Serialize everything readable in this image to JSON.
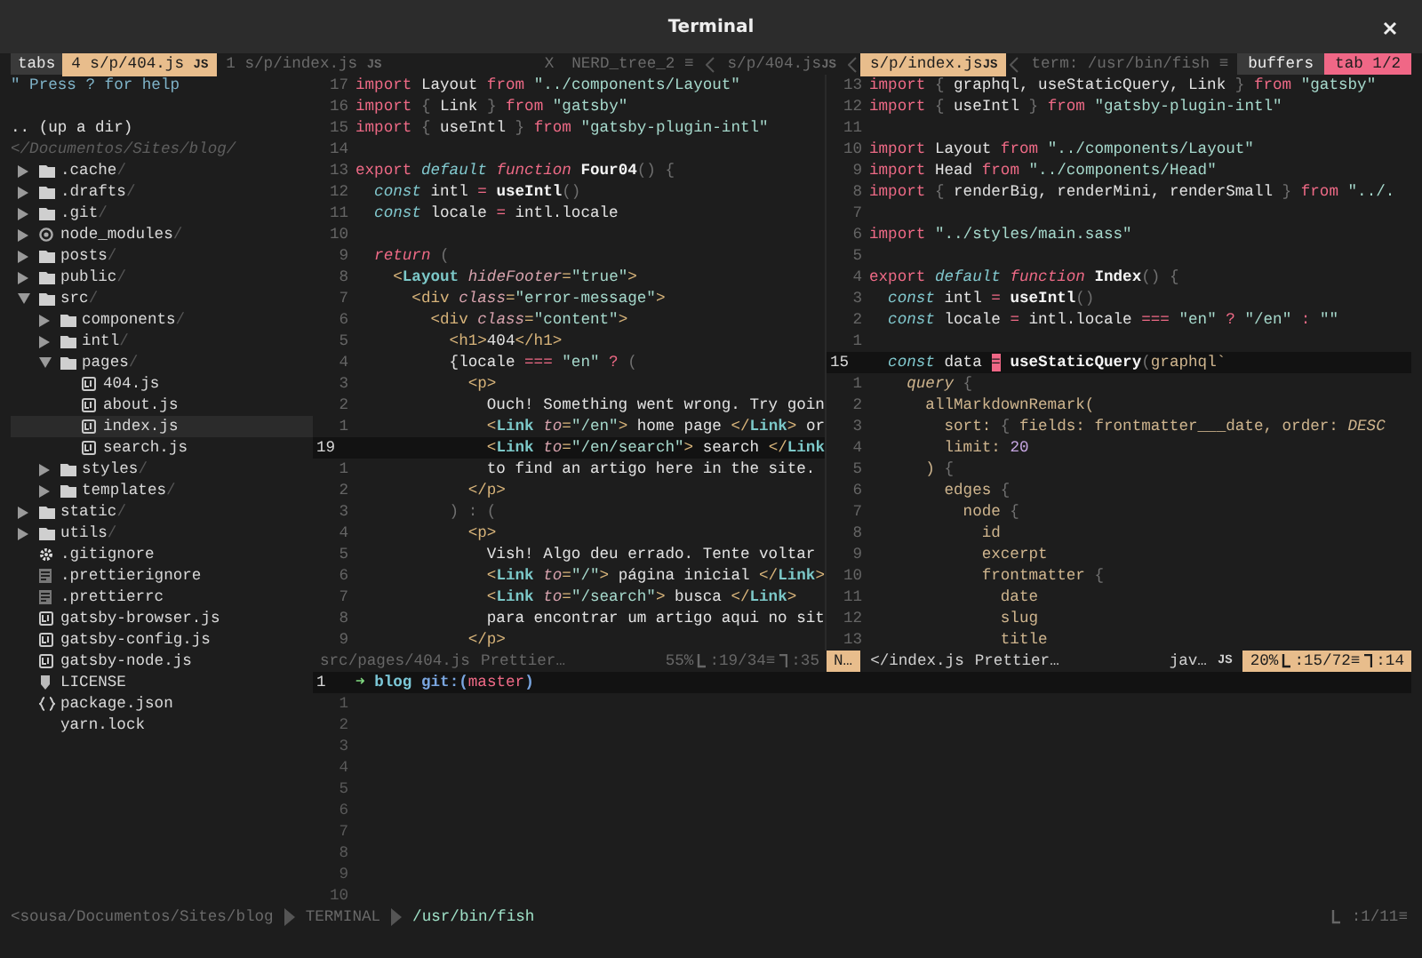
{
  "window": {
    "title": "Terminal"
  },
  "topbar": {
    "tabs_label": "tabs",
    "tabs": [
      {
        "text": "4 s/p/404.js",
        "badge": "JS",
        "selected": true
      },
      {
        "text": "1 s/p/index.js",
        "badge": "JS",
        "selected": false
      }
    ],
    "buffers": [
      {
        "text": "X",
        "selected": false
      },
      {
        "text": "NERD_tree_2 ≡",
        "selected": false
      },
      {
        "text": "s/p/404.js",
        "badge": "JS",
        "selected": false
      },
      {
        "text": "s/p/index.js",
        "badge": "JS",
        "selected": true
      },
      {
        "text": "term: /usr/bin/fish ≡",
        "selected": false
      }
    ],
    "buffers_label": "buffers",
    "tab_indicator": "tab 1/2"
  },
  "tree": {
    "help": "\" Press ? for help",
    "up": ".. (up a dir)",
    "path": "</Documentos/Sites/blog/",
    "items": [
      {
        "name": ".cache",
        "suffix": "/",
        "kind": "folder",
        "expanded": false,
        "selected": false
      },
      {
        "name": ".drafts",
        "suffix": "/",
        "kind": "folder",
        "expanded": false,
        "selected": false
      },
      {
        "name": ".git",
        "suffix": "/",
        "kind": "folder",
        "expanded": false,
        "selected": false
      },
      {
        "name": "node_modules",
        "suffix": "/",
        "kind": "module",
        "expanded": false,
        "selected": false
      },
      {
        "name": "posts",
        "suffix": "/",
        "kind": "folder",
        "expanded": false,
        "selected": false
      },
      {
        "name": "public",
        "suffix": "/",
        "kind": "folder",
        "expanded": false,
        "selected": false
      },
      {
        "name": "src",
        "suffix": "/",
        "kind": "folder",
        "expanded": true,
        "selected": false,
        "children": [
          {
            "name": "components",
            "suffix": "/",
            "kind": "folder",
            "expanded": false,
            "selected": false
          },
          {
            "name": "intl",
            "suffix": "/",
            "kind": "folder",
            "expanded": false,
            "selected": false
          },
          {
            "name": "pages",
            "suffix": "/",
            "kind": "folder",
            "expanded": true,
            "selected": false,
            "children": [
              {
                "name": "404.js",
                "kind": "js",
                "selected": false
              },
              {
                "name": "about.js",
                "kind": "js",
                "selected": false
              },
              {
                "name": "index.js",
                "kind": "js",
                "selected": true
              },
              {
                "name": "search.js",
                "kind": "js",
                "selected": false
              }
            ]
          },
          {
            "name": "styles",
            "suffix": "/",
            "kind": "folder",
            "expanded": false,
            "selected": false
          },
          {
            "name": "templates",
            "suffix": "/",
            "kind": "folder",
            "expanded": false,
            "selected": false
          }
        ]
      },
      {
        "name": "static",
        "suffix": "/",
        "kind": "folder",
        "expanded": false,
        "selected": false
      },
      {
        "name": "utils",
        "suffix": "/",
        "kind": "folder",
        "expanded": false,
        "selected": false
      },
      {
        "name": ".gitignore",
        "kind": "config",
        "selected": false
      },
      {
        "name": ".prettierignore",
        "kind": "text",
        "selected": false
      },
      {
        "name": ".prettierrc",
        "kind": "text",
        "selected": false
      },
      {
        "name": "gatsby-browser.js",
        "kind": "js",
        "selected": false
      },
      {
        "name": "gatsby-config.js",
        "kind": "js",
        "selected": false
      },
      {
        "name": "gatsby-node.js",
        "kind": "js",
        "selected": false
      },
      {
        "name": "LICENSE",
        "kind": "license",
        "selected": false
      },
      {
        "name": "package.json",
        "kind": "json",
        "selected": false
      },
      {
        "name": "yarn.lock",
        "kind": "lock",
        "selected": false
      }
    ]
  },
  "editors": [
    {
      "lines": [
        {
          "num": "17",
          "current": false,
          "tokens": [
            {
              "kind": "k",
              "text": "import"
            },
            {
              "kind": "t",
              "text": " Layout "
            },
            {
              "kind": "k",
              "text": "from"
            },
            {
              "kind": "s",
              "text": " \"../components/Layout\""
            }
          ]
        },
        {
          "num": "16",
          "current": false,
          "tokens": [
            {
              "kind": "k",
              "text": "import"
            },
            {
              "kind": "p",
              "text": " {"
            },
            {
              "kind": "t",
              "text": " Link "
            },
            {
              "kind": "p",
              "text": "}"
            },
            {
              "kind": "k",
              "text": " from"
            },
            {
              "kind": "s",
              "text": " \"gatsby\""
            }
          ]
        },
        {
          "num": "15",
          "current": false,
          "tokens": [
            {
              "kind": "k",
              "text": "import"
            },
            {
              "kind": "p",
              "text": " {"
            },
            {
              "kind": "t",
              "text": " useIntl "
            },
            {
              "kind": "p",
              "text": "}"
            },
            {
              "kind": "k",
              "text": " from"
            },
            {
              "kind": "s",
              "text": " \"gatsby-plugin-intl\""
            }
          ]
        },
        {
          "num": "14",
          "current": false
        },
        {
          "num": "13",
          "current": false,
          "tokens": [
            {
              "kind": "k",
              "text": "export"
            },
            {
              "kind": "ci",
              "text": " default"
            },
            {
              "kind": "ki",
              "text": " function"
            },
            {
              "kind": "fn",
              "text": " Four04"
            },
            {
              "kind": "p",
              "text": "() {"
            }
          ]
        },
        {
          "num": "12",
          "current": false,
          "tokens": [
            {
              "kind": "ci",
              "text": "  const"
            },
            {
              "kind": "t",
              "text": " intl "
            },
            {
              "kind": "op",
              "text": "="
            },
            {
              "kind": "fn",
              "text": " useIntl"
            },
            {
              "kind": "p",
              "text": "()"
            }
          ]
        },
        {
          "num": "11",
          "current": false,
          "tokens": [
            {
              "kind": "ci",
              "text": "  const"
            },
            {
              "kind": "t",
              "text": " locale "
            },
            {
              "kind": "op",
              "text": "="
            },
            {
              "kind": "t",
              "text": " intl.locale"
            }
          ]
        },
        {
          "num": "10",
          "current": false
        },
        {
          "num": "9",
          "current": false,
          "tokens": [
            {
              "kind": "ki",
              "text": "  return"
            },
            {
              "kind": "p",
              "text": " ("
            }
          ]
        },
        {
          "num": "8",
          "current": false,
          "tokens": [
            {
              "kind": "tg",
              "text": "    <"
            },
            {
              "kind": "cp",
              "text": "Layout"
            },
            {
              "kind": "a",
              "text": " hideFooter"
            },
            {
              "kind": "tg",
              "text": "="
            },
            {
              "kind": "s",
              "text": "\"true\""
            },
            {
              "kind": "tg",
              "text": ">"
            }
          ]
        },
        {
          "num": "7",
          "current": false,
          "tokens": [
            {
              "kind": "tg",
              "text": "      <div"
            },
            {
              "kind": "a",
              "text": " class"
            },
            {
              "kind": "tg",
              "text": "="
            },
            {
              "kind": "s",
              "text": "\"error-message\""
            },
            {
              "kind": "tg",
              "text": ">"
            }
          ]
        },
        {
          "num": "6",
          "current": false,
          "tokens": [
            {
              "kind": "tg",
              "text": "        <div"
            },
            {
              "kind": "a",
              "text": " class"
            },
            {
              "kind": "tg",
              "text": "="
            },
            {
              "kind": "s",
              "text": "\"content\""
            },
            {
              "kind": "tg",
              "text": ">"
            }
          ]
        },
        {
          "num": "5",
          "current": false,
          "tokens": [
            {
              "kind": "tg",
              "text": "          <h1>"
            },
            {
              "kind": "t",
              "text": "404"
            },
            {
              "kind": "tg",
              "text": "</h1>"
            }
          ]
        },
        {
          "num": "4",
          "current": false,
          "tokens": [
            {
              "kind": "t",
              "text": "          {locale "
            },
            {
              "kind": "op",
              "text": "==="
            },
            {
              "kind": "s",
              "text": " \"en\""
            },
            {
              "kind": "op",
              "text": " ?"
            },
            {
              "kind": "p",
              "text": " ("
            }
          ]
        },
        {
          "num": "3",
          "current": false,
          "tokens": [
            {
              "kind": "tg",
              "text": "            <p>"
            }
          ]
        },
        {
          "num": "2",
          "current": false,
          "tokens": [
            {
              "kind": "t",
              "text": "              Ouch! Something went wrong. Try goin"
            }
          ]
        },
        {
          "num": "1",
          "current": false,
          "tokens": [
            {
              "kind": "tg",
              "text": "              <"
            },
            {
              "kind": "cp",
              "text": "Link"
            },
            {
              "kind": "a",
              "text": " to"
            },
            {
              "kind": "tg",
              "text": "="
            },
            {
              "kind": "s",
              "text": "\"/en\""
            },
            {
              "kind": "tg",
              "text": ">"
            },
            {
              "kind": "t",
              "text": " home page "
            },
            {
              "kind": "tg",
              "text": "</"
            },
            {
              "kind": "cp",
              "text": "Link"
            },
            {
              "kind": "tg",
              "text": ">"
            },
            {
              "kind": "t",
              "text": " or"
            }
          ]
        },
        {
          "num": "19",
          "current": true,
          "tokens": [
            {
              "kind": "tg",
              "text": "              <"
            },
            {
              "kind": "cp",
              "text": "Link"
            },
            {
              "kind": "a",
              "text": " to"
            },
            {
              "kind": "tg",
              "text": "="
            },
            {
              "kind": "s",
              "text": "\"/en/search\""
            },
            {
              "kind": "tg",
              "text": ">"
            },
            {
              "kind": "t",
              "text": " search "
            },
            {
              "kind": "tg",
              "text": "</"
            },
            {
              "kind": "cp",
              "text": "Link"
            }
          ]
        },
        {
          "num": "1",
          "current": false,
          "tokens": [
            {
              "kind": "t",
              "text": "              to find an artigo here in the site."
            }
          ]
        },
        {
          "num": "2",
          "current": false,
          "tokens": [
            {
              "kind": "tg",
              "text": "            </p>"
            }
          ]
        },
        {
          "num": "3",
          "current": false,
          "tokens": [
            {
              "kind": "p",
              "text": "          ) : ("
            }
          ]
        },
        {
          "num": "4",
          "current": false,
          "tokens": [
            {
              "kind": "tg",
              "text": "            <p>"
            }
          ]
        },
        {
          "num": "5",
          "current": false,
          "tokens": [
            {
              "kind": "t",
              "text": "              Vish! Algo deu errado. Tente voltar"
            }
          ]
        },
        {
          "num": "6",
          "current": false,
          "tokens": [
            {
              "kind": "tg",
              "text": "              <"
            },
            {
              "kind": "cp",
              "text": "Link"
            },
            {
              "kind": "a",
              "text": " to"
            },
            {
              "kind": "tg",
              "text": "="
            },
            {
              "kind": "s",
              "text": "\"/\""
            },
            {
              "kind": "tg",
              "text": ">"
            },
            {
              "kind": "t",
              "text": " página inicial "
            },
            {
              "kind": "tg",
              "text": "</"
            },
            {
              "kind": "cp",
              "text": "Link"
            },
            {
              "kind": "tg",
              "text": ">"
            }
          ]
        },
        {
          "num": "7",
          "current": false,
          "tokens": [
            {
              "kind": "tg",
              "text": "              <"
            },
            {
              "kind": "cp",
              "text": "Link"
            },
            {
              "kind": "a",
              "text": " to"
            },
            {
              "kind": "tg",
              "text": "="
            },
            {
              "kind": "s",
              "text": "\"/search\""
            },
            {
              "kind": "tg",
              "text": ">"
            },
            {
              "kind": "t",
              "text": " busca "
            },
            {
              "kind": "tg",
              "text": "</"
            },
            {
              "kind": "cp",
              "text": "Link"
            },
            {
              "kind": "tg",
              "text": ">"
            }
          ]
        },
        {
          "num": "8",
          "current": false,
          "tokens": [
            {
              "kind": "t",
              "text": "              para encontrar um artigo aqui no sit"
            }
          ]
        },
        {
          "num": "9",
          "current": false,
          "tokens": [
            {
              "kind": "tg",
              "text": "            </p>"
            }
          ]
        }
      ],
      "status": {
        "active": false,
        "file": "src/pages/404.js",
        "formatter": "Prettier…",
        "percent": "55%",
        "line": ":19/34≡",
        "column": ":35"
      }
    },
    {
      "lines": [
        {
          "num": "13",
          "current": false,
          "tokens": [
            {
              "kind": "k",
              "text": "import"
            },
            {
              "kind": "p",
              "text": " {"
            },
            {
              "kind": "t",
              "text": " graphql, useStaticQuery, Link "
            },
            {
              "kind": "p",
              "text": "}"
            },
            {
              "kind": "k",
              "text": " from"
            },
            {
              "kind": "s",
              "text": " \"gatsby\""
            }
          ]
        },
        {
          "num": "12",
          "current": false,
          "tokens": [
            {
              "kind": "k",
              "text": "import"
            },
            {
              "kind": "p",
              "text": " {"
            },
            {
              "kind": "t",
              "text": " useIntl "
            },
            {
              "kind": "p",
              "text": "}"
            },
            {
              "kind": "k",
              "text": " from"
            },
            {
              "kind": "s",
              "text": " \"gatsby-plugin-intl\""
            }
          ]
        },
        {
          "num": "11",
          "current": false
        },
        {
          "num": "10",
          "current": false,
          "tokens": [
            {
              "kind": "k",
              "text": "import"
            },
            {
              "kind": "t",
              "text": " Layout "
            },
            {
              "kind": "k",
              "text": "from"
            },
            {
              "kind": "s",
              "text": " \"../components/Layout\""
            }
          ]
        },
        {
          "num": "9",
          "current": false,
          "tokens": [
            {
              "kind": "k",
              "text": "import"
            },
            {
              "kind": "t",
              "text": " Head "
            },
            {
              "kind": "k",
              "text": "from"
            },
            {
              "kind": "s",
              "text": " \"../components/Head\""
            }
          ]
        },
        {
          "num": "8",
          "current": false,
          "tokens": [
            {
              "kind": "k",
              "text": "import"
            },
            {
              "kind": "p",
              "text": " {"
            },
            {
              "kind": "t",
              "text": " renderBig, renderMini, renderSmall "
            },
            {
              "kind": "p",
              "text": "}"
            },
            {
              "kind": "k",
              "text": " from"
            },
            {
              "kind": "s",
              "text": " \"../."
            }
          ]
        },
        {
          "num": "7",
          "current": false
        },
        {
          "num": "6",
          "current": false,
          "tokens": [
            {
              "kind": "k",
              "text": "import"
            },
            {
              "kind": "s",
              "text": " \"../styles/main.sass\""
            }
          ]
        },
        {
          "num": "5",
          "current": false
        },
        {
          "num": "4",
          "current": false,
          "tokens": [
            {
              "kind": "k",
              "text": "export"
            },
            {
              "kind": "ci",
              "text": " default"
            },
            {
              "kind": "ki",
              "text": " function"
            },
            {
              "kind": "fn",
              "text": " Index"
            },
            {
              "kind": "p",
              "text": "() {"
            }
          ]
        },
        {
          "num": "3",
          "current": false,
          "tokens": [
            {
              "kind": "ci",
              "text": "  const"
            },
            {
              "kind": "t",
              "text": " intl "
            },
            {
              "kind": "op",
              "text": "="
            },
            {
              "kind": "fn",
              "text": " useIntl"
            },
            {
              "kind": "p",
              "text": "()"
            }
          ]
        },
        {
          "num": "2",
          "current": false,
          "tokens": [
            {
              "kind": "ci",
              "text": "  const"
            },
            {
              "kind": "t",
              "text": " locale "
            },
            {
              "kind": "op",
              "text": "="
            },
            {
              "kind": "t",
              "text": " intl.locale "
            },
            {
              "kind": "op",
              "text": "==="
            },
            {
              "kind": "s",
              "text": " \"en\""
            },
            {
              "kind": "op",
              "text": " ?"
            },
            {
              "kind": "s",
              "text": " \"/en\""
            },
            {
              "kind": "op",
              "text": " :"
            },
            {
              "kind": "s",
              "text": " \"\""
            }
          ]
        },
        {
          "num": "1",
          "current": false
        },
        {
          "num": "15",
          "current": true,
          "tokens": [
            {
              "kind": "ci",
              "text": "  const"
            },
            {
              "kind": "t",
              "text": " data "
            },
            {
              "kind": "cur",
              "text": "="
            },
            {
              "kind": "fn",
              "text": " useStaticQuery"
            },
            {
              "kind": "p",
              "text": "("
            },
            {
              "kind": "g",
              "text": "graphql`"
            }
          ]
        },
        {
          "num": "1",
          "current": false,
          "tokens": [
            {
              "kind": "q",
              "text": "    query"
            },
            {
              "kind": "p",
              "text": " {"
            }
          ]
        },
        {
          "num": "2",
          "current": false,
          "tokens": [
            {
              "kind": "g",
              "text": "      allMarkdownRemark("
            }
          ]
        },
        {
          "num": "3",
          "current": false,
          "tokens": [
            {
              "kind": "g",
              "text": "        sort: "
            },
            {
              "kind": "p",
              "text": "{"
            },
            {
              "kind": "g",
              "text": " fields: frontmatter___date, order: "
            },
            {
              "kind": "q",
              "text": "DESC"
            }
          ]
        },
        {
          "num": "4",
          "current": false,
          "tokens": [
            {
              "kind": "g",
              "text": "        limit: "
            },
            {
              "kind": "n",
              "text": "20"
            }
          ]
        },
        {
          "num": "5",
          "current": false,
          "tokens": [
            {
              "kind": "g",
              "text": "      )"
            },
            {
              "kind": "p",
              "text": " {"
            }
          ]
        },
        {
          "num": "6",
          "current": false,
          "tokens": [
            {
              "kind": "g",
              "text": "        edges"
            },
            {
              "kind": "p",
              "text": " {"
            }
          ]
        },
        {
          "num": "7",
          "current": false,
          "tokens": [
            {
              "kind": "g",
              "text": "          node"
            },
            {
              "kind": "p",
              "text": " {"
            }
          ]
        },
        {
          "num": "8",
          "current": false,
          "tokens": [
            {
              "kind": "g",
              "text": "            id"
            }
          ]
        },
        {
          "num": "9",
          "current": false,
          "tokens": [
            {
              "kind": "g",
              "text": "            excerpt"
            }
          ]
        },
        {
          "num": "10",
          "current": false,
          "tokens": [
            {
              "kind": "g",
              "text": "            frontmatter"
            },
            {
              "kind": "p",
              "text": " {"
            }
          ]
        },
        {
          "num": "11",
          "current": false,
          "tokens": [
            {
              "kind": "g",
              "text": "              date"
            }
          ]
        },
        {
          "num": "12",
          "current": false,
          "tokens": [
            {
              "kind": "g",
              "text": "              slug"
            }
          ]
        },
        {
          "num": "13",
          "current": false,
          "tokens": [
            {
              "kind": "g",
              "text": "              title"
            }
          ]
        }
      ],
      "status": {
        "active": true,
        "mode": "N…",
        "file": "</index.js",
        "formatter": "Prettier…",
        "filetype": "jav…",
        "badge": "JS",
        "percent": "20%",
        "line": ":15/72≡",
        "column": ":14"
      }
    }
  ],
  "terminal": {
    "lines": [
      {
        "num": "1",
        "current": true,
        "tokens": [
          {
            "kind": "arrow",
            "text": "➜"
          },
          {
            "kind": "dir",
            "text": " blog"
          },
          {
            "kind": "git",
            "text": " git:("
          },
          {
            "kind": "br",
            "text": "master"
          },
          {
            "kind": "git",
            "text": ")"
          }
        ]
      },
      {
        "num": "1",
        "current": false
      },
      {
        "num": "2",
        "current": false
      },
      {
        "num": "3",
        "current": false
      },
      {
        "num": "4",
        "current": false
      },
      {
        "num": "5",
        "current": false
      },
      {
        "num": "6",
        "current": false
      },
      {
        "num": "7",
        "current": false
      },
      {
        "num": "8",
        "current": false
      },
      {
        "num": "9",
        "current": false
      },
      {
        "num": "10",
        "current": false
      }
    ]
  },
  "bottom_status": {
    "cwd": "<sousa/Documentos/Sites/blog",
    "mode": "TERMINAL",
    "shell": "/usr/bin/fish",
    "line": ":1/11≡"
  }
}
